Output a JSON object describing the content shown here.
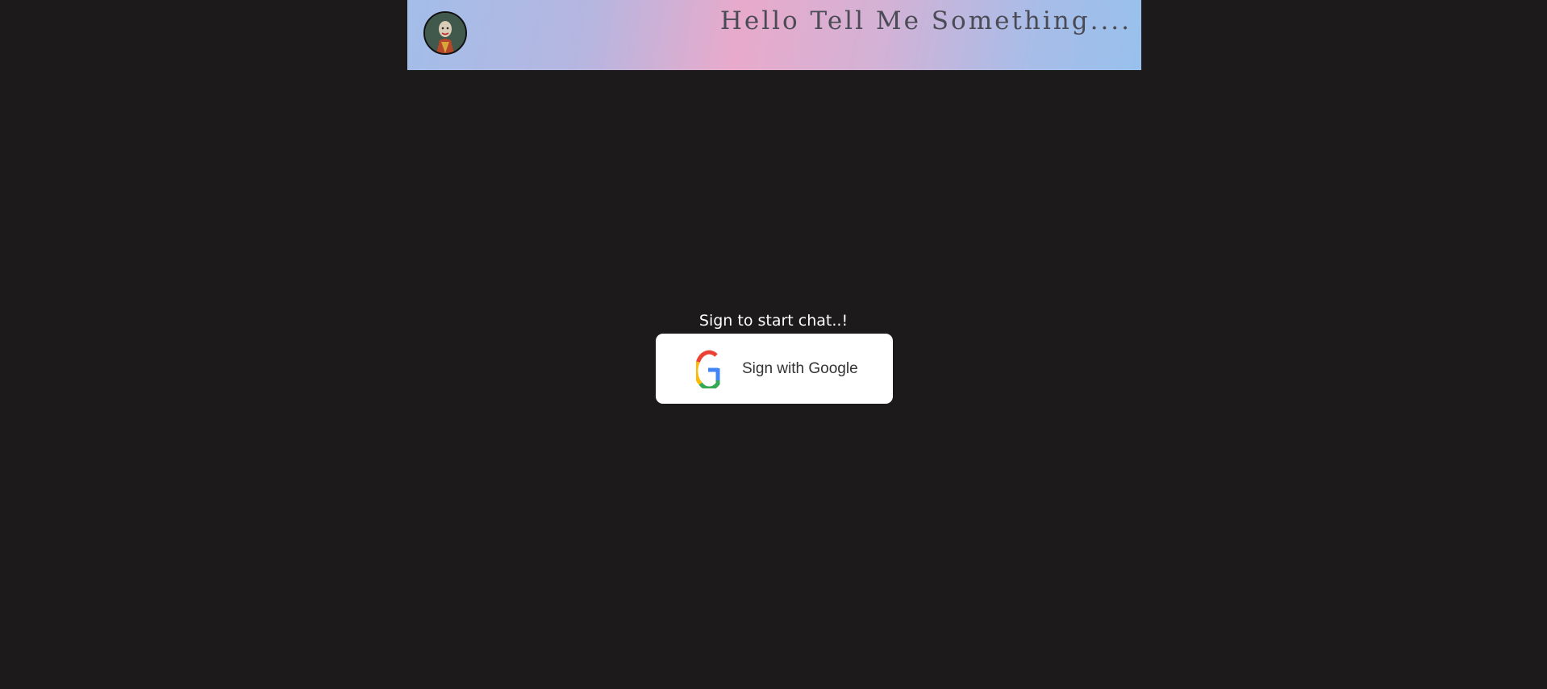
{
  "header": {
    "title": "Hello Tell Me Something....",
    "avatar_icon": "joker-avatar-icon"
  },
  "main": {
    "prompt": "Sign to start chat..!",
    "google_button": {
      "label": "Sign with Google",
      "icon": "google-icon"
    }
  },
  "colors": {
    "background": "#1c1a1b",
    "header_gradient": [
      "#a2bee9",
      "#e8aacb",
      "#98c0ec"
    ],
    "title_text": "#4b4b55",
    "google_blue": "#4285F4",
    "google_red": "#EA4335",
    "google_yellow": "#FBBC05",
    "google_green": "#34A853"
  }
}
